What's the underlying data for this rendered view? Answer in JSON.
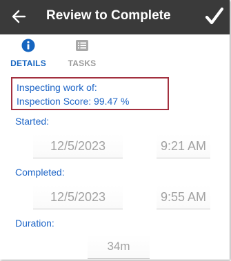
{
  "header": {
    "title": "Review to Complete",
    "back_icon": "arrow-left-icon",
    "confirm_icon": "checkmark-icon",
    "background": "#3a3a3a"
  },
  "tabs": [
    {
      "label": "DETAILS",
      "icon": "info-circle-icon",
      "active": true,
      "color": "#1565c0"
    },
    {
      "label": "TASKS",
      "icon": "list-icon",
      "active": false,
      "color": "#9a9a9a"
    }
  ],
  "info": {
    "inspecting_text": "Inspecting work of:",
    "score_text": "Inspection Score: 99.47 %",
    "highlight_color": "#a3303f"
  },
  "fields": {
    "started": {
      "label": "Started:",
      "date": "12/5/2023",
      "time": "9:21 AM"
    },
    "completed": {
      "label": "Completed:",
      "date": "12/5/2023",
      "time": "9:55 AM"
    },
    "duration": {
      "label": "Duration:",
      "value": "34m"
    }
  },
  "colors": {
    "accent_blue": "#1f66c7",
    "value_gray": "#a2a2a2"
  }
}
